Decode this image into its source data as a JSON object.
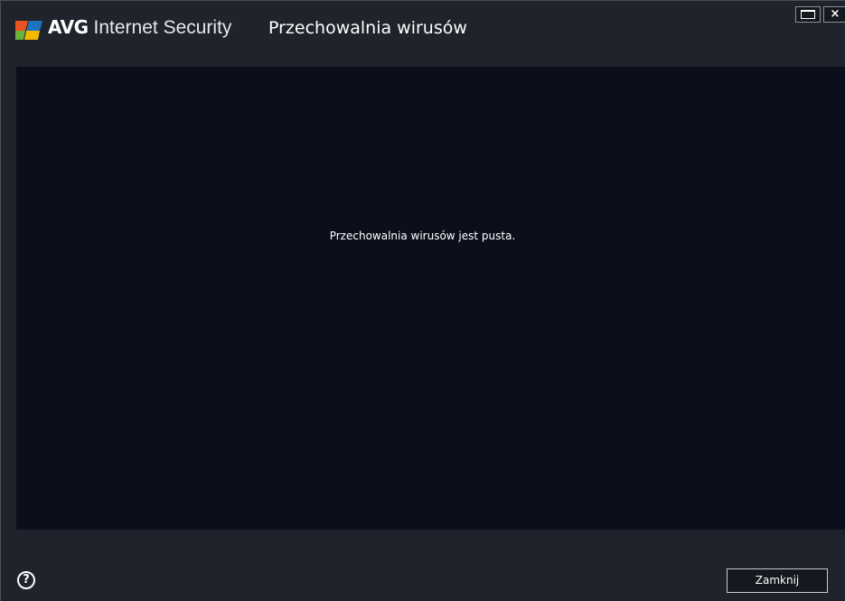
{
  "window": {
    "brand_name": "AVG",
    "product_name": "Internet Security",
    "title": "Przechowalnia wirusów",
    "controls": {
      "maximize_icon": "maximize-icon",
      "close_glyph": "×"
    }
  },
  "main": {
    "empty_message": "Przechowalnia wirusów jest pusta."
  },
  "footer": {
    "help_glyph": "?",
    "close_label": "Zamknij"
  },
  "colors": {
    "content_background": "#0b0f1c",
    "chrome_background": "#1f232b",
    "logo_orange": "#e8531f",
    "logo_green": "#6cb33e",
    "logo_blue": "#1e73be",
    "logo_yellow": "#f5b800"
  }
}
